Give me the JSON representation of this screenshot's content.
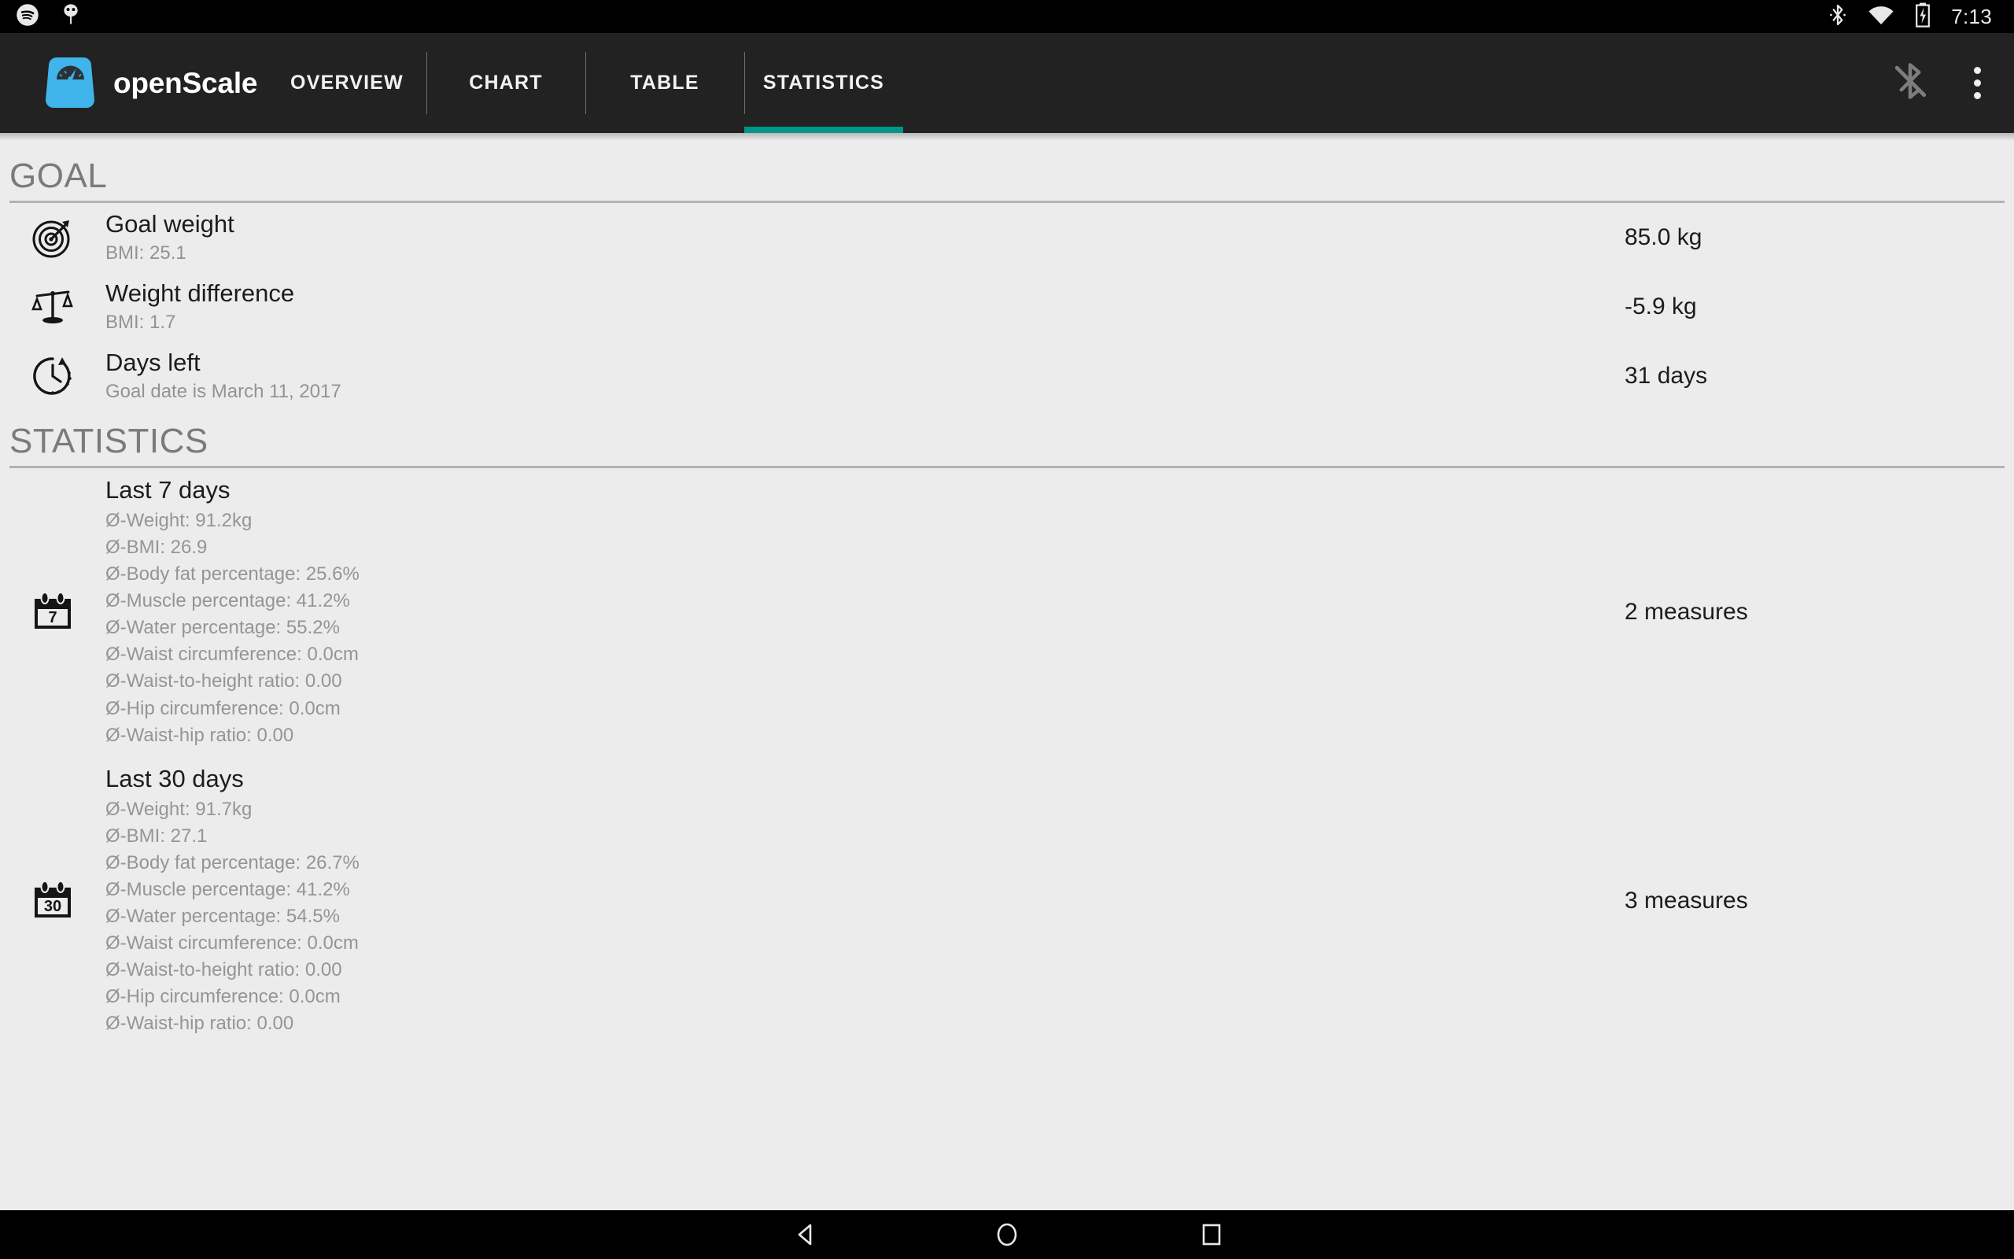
{
  "statusbar": {
    "left_icons": [
      "spotify-icon",
      "android-debug-icon"
    ],
    "right_icons": [
      "bluetooth-icon",
      "wifi-icon",
      "battery-charging-icon"
    ],
    "clock": "7:13"
  },
  "appbar": {
    "logo_icon": "openscale-logo-icon",
    "app_name": "openScale",
    "tabs": [
      {
        "label": "OVERVIEW",
        "active": false
      },
      {
        "label": "CHART",
        "active": false
      },
      {
        "label": "TABLE",
        "active": false
      },
      {
        "label": "STATISTICS",
        "active": true
      }
    ],
    "actions": [
      {
        "icon": "bluetooth-disabled-icon",
        "label": "Bluetooth disabled"
      },
      {
        "icon": "overflow-menu-icon",
        "label": "More options"
      }
    ],
    "accent_color": "#009688",
    "bar_color": "#222222"
  },
  "goal": {
    "heading": "GOAL",
    "rows": [
      {
        "icon": "target-icon",
        "title": "Goal weight",
        "subtitle": "BMI: 25.1",
        "value": "85.0 kg"
      },
      {
        "icon": "balance-scale-icon",
        "title": "Weight difference",
        "subtitle": "BMI: 1.7",
        "value": "-5.9 kg"
      },
      {
        "icon": "clock-update-icon",
        "title": "Days left",
        "subtitle": "Goal date is March 11, 2017",
        "value": "31 days"
      }
    ]
  },
  "statistics": {
    "heading": "STATISTICS",
    "rows": [
      {
        "icon": "calendar-7-icon",
        "icon_number": "7",
        "title": "Last 7 days",
        "lines": [
          "Ø-Weight: 91.2kg",
          "Ø-BMI: 26.9",
          "Ø-Body fat percentage: 25.6%",
          "Ø-Muscle percentage: 41.2%",
          "Ø-Water percentage: 55.2%",
          "Ø-Waist circumference: 0.0cm",
          "Ø-Waist-to-height ratio: 0.00",
          "Ø-Hip circumference: 0.0cm",
          "Ø-Waist-hip ratio: 0.00"
        ],
        "value": "2 measures"
      },
      {
        "icon": "calendar-30-icon",
        "icon_number": "30",
        "title": "Last 30 days",
        "lines": [
          "Ø-Weight: 91.7kg",
          "Ø-BMI: 27.1",
          "Ø-Body fat percentage: 26.7%",
          "Ø-Muscle percentage: 41.2%",
          "Ø-Water percentage: 54.5%",
          "Ø-Waist circumference: 0.0cm",
          "Ø-Waist-to-height ratio: 0.00",
          "Ø-Hip circumference: 0.0cm",
          "Ø-Waist-hip ratio: 0.00"
        ],
        "value": "3 measures"
      }
    ]
  },
  "navbar": {
    "back": "back-icon",
    "home": "home-icon",
    "recents": "recents-icon"
  }
}
